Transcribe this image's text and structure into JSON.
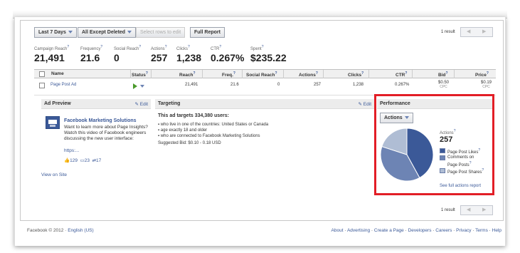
{
  "toolbar": {
    "date_range": "Last 7 Days",
    "filter": "All Except Deleted",
    "select_rows": "Select rows to edit",
    "full_report": "Full Report",
    "result_count": "1 result"
  },
  "stats": [
    {
      "label": "Campaign Reach",
      "q": "?",
      "value": "21,491"
    },
    {
      "label": "Frequency",
      "q": "?",
      "value": "21.6"
    },
    {
      "label": "Social Reach",
      "q": "?",
      "value": "0"
    },
    {
      "label": "Actions",
      "q": "?",
      "value": "257"
    },
    {
      "label": "Clicks",
      "q": "?",
      "value": "1,238"
    },
    {
      "label": "CTR",
      "q": "?",
      "value": "0.267%"
    },
    {
      "label": "Spent",
      "q": "?",
      "value": "$235.22"
    }
  ],
  "table": {
    "headers": {
      "name": "Name",
      "status": "Status",
      "reach": "Reach",
      "freq": "Freq.",
      "social_reach": "Social Reach",
      "actions": "Actions",
      "clicks": "Clicks",
      "ctr": "CTR",
      "bid": "Bid",
      "price": "Price"
    },
    "row": {
      "name": "Page Post Ad",
      "reach": "21,491",
      "freq": "21.6",
      "social_reach": "0",
      "actions": "257",
      "clicks": "1,238",
      "ctr": "0.267%",
      "bid": "$0.50",
      "bid_unit": "CPC",
      "price": "$0.19",
      "price_unit": "CPC"
    }
  },
  "ad_preview": {
    "title": "Ad Preview",
    "edit": "Edit",
    "ad_title": "Facebook Marketing Solutions",
    "ad_body": "Want to learn more about Page Insights? Watch this video of Facebook engineers discussing the new user interface:",
    "ad_link": "https:...",
    "likes": "129",
    "comments": "23",
    "shares": "17",
    "view_on_site": "View on Site"
  },
  "targeting": {
    "title": "Targeting",
    "edit": "Edit",
    "headline": "This ad targets 334,380 users:",
    "items": [
      "who live in one of the countries: United States or Canada",
      "age exactly 18 and older",
      "who are connected to Facebook Marketing Solutions"
    ],
    "suggested_bid": "Suggested Bid: $0.10 - 0.18 USD"
  },
  "performance": {
    "title": "Performance",
    "dropdown": "Actions",
    "metric_label": "Actions",
    "q": "?",
    "metric_value": "257",
    "legend": [
      {
        "label": "Page Post Likes",
        "q": "?",
        "color": "#3b5998"
      },
      {
        "label": "Comments on Page Posts",
        "q": "?",
        "color": "#6d84b4"
      },
      {
        "label": "Page Post Shares",
        "q": "?",
        "color": "#afbdd4"
      }
    ],
    "full_report_link": "See full actions report"
  },
  "chart_data": {
    "type": "pie",
    "categories": [
      "Page Post Likes",
      "Comments on Page Posts",
      "Page Post Shares"
    ],
    "values": [
      42,
      38,
      20
    ],
    "colors": [
      "#3b5998",
      "#6d84b4",
      "#afbdd4"
    ]
  },
  "footer": {
    "copyright": "Facebook © 2012 ·",
    "language": "English (US)",
    "links": [
      "About",
      "Advertising",
      "Create a Page",
      "Developers",
      "Careers",
      "Privacy",
      "Terms",
      "Help"
    ]
  }
}
